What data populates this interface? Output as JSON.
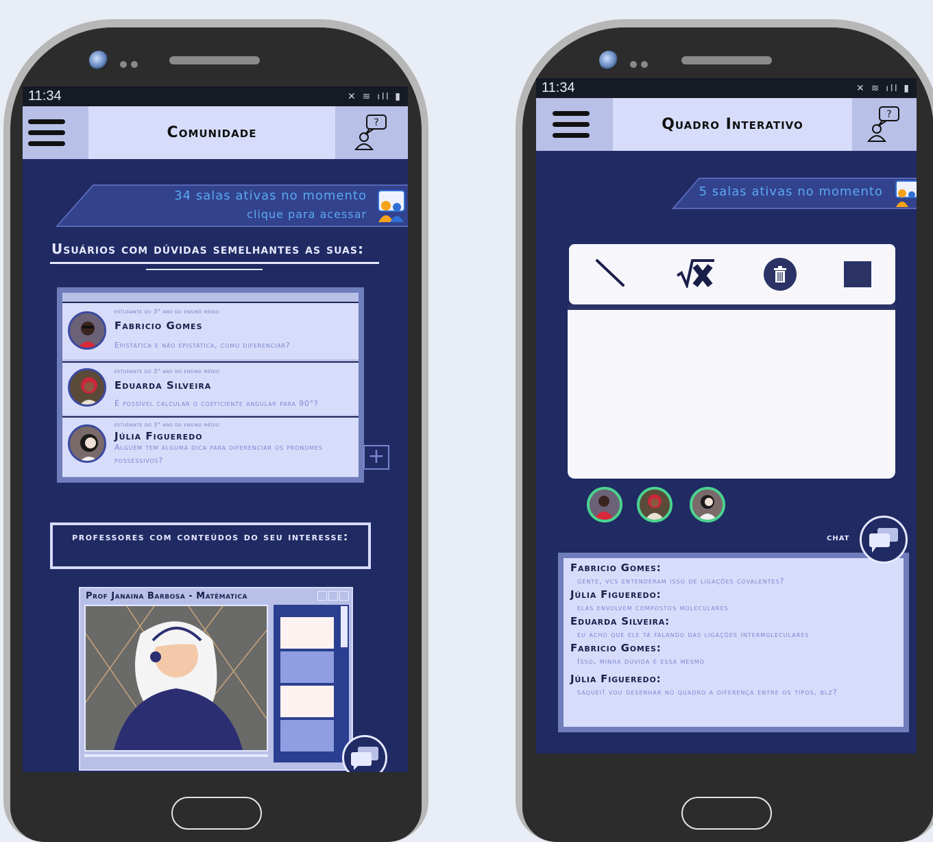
{
  "phones": [
    {
      "status": {
        "time": "11:34"
      },
      "appbar": {
        "title": "Comunidade"
      },
      "banner": {
        "line1": "34 salas ativas no momento",
        "line2": "clique para acessar"
      },
      "similar_section": {
        "title": "Usuários com dúvidas semelhantes as suas:",
        "users": [
          {
            "kicker": "estudante do 3° ano do ensino médio",
            "name": "Fabricio Gomes",
            "question": "Epistática e não epistática, como diferenciar?"
          },
          {
            "kicker": "estudante do 3° ano do ensino médio",
            "name": "Eduarda Silveira",
            "question": "É possível calcular o coeficiente angular para 90°?"
          },
          {
            "kicker": "estudante do 3° ano do ensino médio",
            "name": "Júlia Figueredo",
            "question": "Alguém tem alguma dica para diferenciar os pronomes possessivos?"
          }
        ]
      },
      "teachers_section": {
        "title": "professores com conteúdos do seu interesse:"
      },
      "video": {
        "title": "Prof Janaina Barbosa - Matématica"
      }
    },
    {
      "status": {
        "time": "11:34"
      },
      "appbar": {
        "title": "Quadro Interativo"
      },
      "banner": {
        "line1": "5 salas ativas no momento"
      },
      "toolbar": {
        "tools": [
          "pen-tool",
          "sqrt-x-tool",
          "trash-tool",
          "shape-tool"
        ]
      },
      "chat": {
        "label": "chat",
        "messages": [
          {
            "name": "Fabricio Gomes:",
            "text": "gente, vcs entenderam isso de ligações covalentes?"
          },
          {
            "name": "Júlia Figueredo:",
            "text": "elas envolvem compostos moleculares"
          },
          {
            "name": "Eduarda Silveira:",
            "text": "eu acho que ele tá falando das ligações intermoleculares"
          },
          {
            "name": "Fabricio Gomes:",
            "text": "Isso, minha dúvida é essa mesmo"
          },
          {
            "name": "Júlia Figueredo:",
            "text": "saquei! vou desenhar no quadro a diferença entre os tipos, blz?"
          }
        ]
      }
    }
  ],
  "colors": {
    "screen_bg": "#202a63",
    "card_bg": "#d7dcfb",
    "accent_text": "#59a9f0",
    "online_ring": "#4bd38f"
  }
}
